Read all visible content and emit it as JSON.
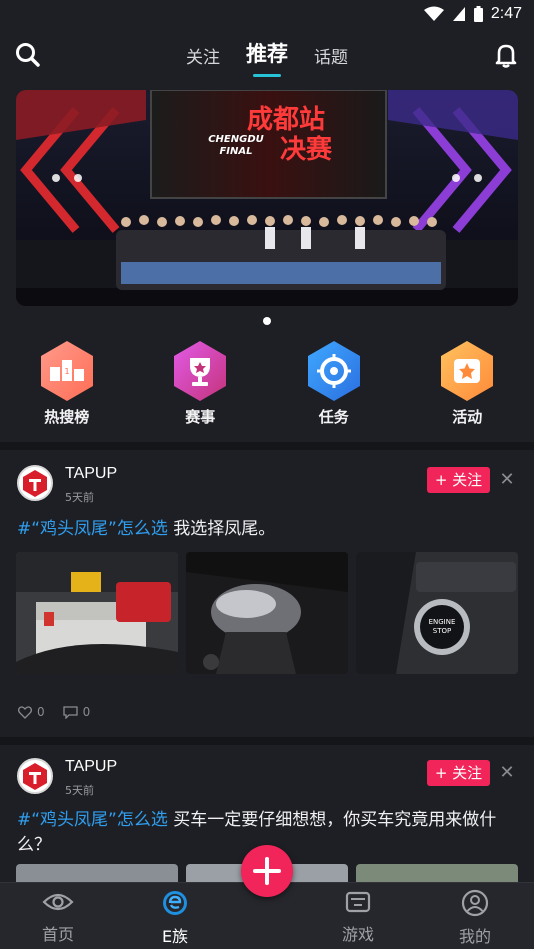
{
  "status_bar": {
    "time": "2:47"
  },
  "top_nav": {
    "tabs": [
      {
        "label": "关注",
        "active": false
      },
      {
        "label": "推荐",
        "active": true
      },
      {
        "label": "话题",
        "active": false
      }
    ]
  },
  "banner": {
    "event_title": "成都站 决赛",
    "event_subtitle_en_1": "CHENGDU",
    "event_subtitle_en_2": "FINAL"
  },
  "quick_entries": [
    {
      "label": "热搜榜",
      "icon": "podium-icon"
    },
    {
      "label": "赛事",
      "icon": "trophy-icon"
    },
    {
      "label": "任务",
      "icon": "target-icon"
    },
    {
      "label": "活动",
      "icon": "star-icon"
    }
  ],
  "posts": [
    {
      "author": "TAPUP",
      "time": "5天前",
      "follow_label": "+ 关注",
      "close_label": "✕",
      "tag": "#“鸡头凤尾”怎么选",
      "text": " 我选择凤尾。",
      "likes": "0",
      "comments": "0"
    },
    {
      "author": "TAPUP",
      "time": "5天前",
      "follow_label": "+ 关注",
      "close_label": "✕",
      "tag": "#“鸡头凤尾”怎么选",
      "text": " 买车一定要仔细想想，你买车究竟用来做什么？"
    }
  ],
  "bottom_nav": [
    {
      "label": "首页",
      "icon": "eye-icon",
      "active": false
    },
    {
      "label": "E族",
      "icon": "e-tribe-icon",
      "active": true
    },
    {
      "label": "游戏",
      "icon": "game-icon",
      "active": false
    },
    {
      "label": "我的",
      "icon": "profile-icon",
      "active": false
    }
  ],
  "colors": {
    "accent": "#f2255a",
    "tab_indicator": "#29c3d8",
    "tag": "#2f9ff0",
    "background": "#1e1f24"
  }
}
